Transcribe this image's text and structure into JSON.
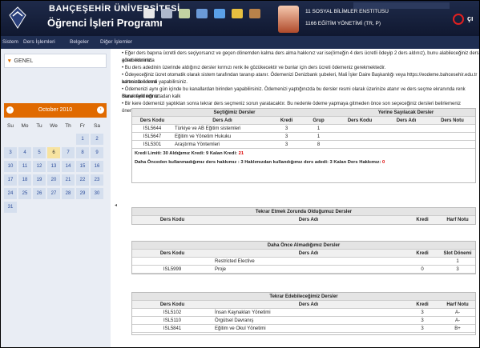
{
  "header": {
    "university": "BAHÇEŞEHİR ÜNİVERSİTESİ",
    "system": "Öğrenci İşleri Programı",
    "institute": "11 SOSYAL BİLİMLER ENSTİTÜSÜ",
    "program": "1166 EĞİTİM YÖNETİMİ (TR, P)",
    "exit": "çı"
  },
  "menu": [
    "Sistem",
    "Ders İşlemleri",
    "Belgeler",
    "Diğer İşlemler"
  ],
  "sidebar": {
    "genel": "GENEL"
  },
  "calendar": {
    "month": "October 2010",
    "dows": [
      "Su",
      "Mo",
      "Tu",
      "We",
      "Th",
      "Fr",
      "Sa"
    ],
    "weeks": [
      [
        "",
        "",
        "",
        "",
        "",
        "1",
        "2"
      ],
      [
        "3",
        "4",
        "5",
        "6",
        "7",
        "8",
        "9"
      ],
      [
        "10",
        "11",
        "12",
        "13",
        "14",
        "15",
        "16"
      ],
      [
        "17",
        "18",
        "19",
        "20",
        "21",
        "22",
        "23"
      ],
      [
        "24",
        "25",
        "26",
        "27",
        "28",
        "29",
        "30"
      ],
      [
        "31",
        "",
        "",
        "",
        "",
        "",
        ""
      ]
    ],
    "today": "6"
  },
  "bullets": [
    "Eğer ders bapına ücretli ders seçiyorsanız ve geçen dönemden kalma ders alma hakkınız var ise(örneğin 4 ders ücretli ödeyip 2 ders aldınız), bunu alabileceğiniz ders adedi kısmında",
    "görecekksiniz.",
    "Bu ders adedinin üzerinde aldığınız dersler kırmızı renk ile gözükecektir ve bunlar için ders ücreti ödemeniz gerekmektedir.",
    "Ödeyeceğiniz ücret otomatik olarak sistem tarafından taranıp atanır. Ödemenizi Denizbank şubeleri, Mali İşler Daire Başkanlığı veya https://eodeme.bahcesehir.edu.tr adresinden kredi",
    "kartınızla ödeme yapabilirsiniz.",
    "Ödemenizi aynı gün içinde bu kanallardan birinden yapabilirsiniz. Ödemenizi yaptığınızda bu dersler resmi olarak üzerinize atanır ve ders seçme ekranında renk olarak farklılığı ortadan kalk",
    "Bunu teyid ediniz.",
    "Bir kere ödemenizi yaptıktan sonra tekrar ders seçmeniz sorun yaratacaktır. Bu nedenle ödeme yapmaya gitmeden önce son seçeceğiniz dersleri belirlemeniz önemlidir."
  ],
  "selected": {
    "title": "Seçtiğimiz Dersler",
    "alt_title": "Yerine Sayılacak Dersler",
    "cols": [
      "Ders Kodu",
      "Ders Adı",
      "Kredi",
      "Grup"
    ],
    "alt_cols": [
      "Ders Kodu",
      "Ders Adı",
      "Ders Notu"
    ],
    "rows": [
      [
        "ISL5644",
        "Türkiye ve AB Eğitim sistemleri",
        "3",
        "1"
      ],
      [
        "ISL5647",
        "Eğitim ve Yönetim Hukuku",
        "3",
        "1"
      ],
      [
        "ISL5301",
        "Araştırma Yöntemleri",
        "3",
        "8"
      ]
    ],
    "limit_text": "Kredi Limiti: 30  Aldığımız Kredi: 9  Kalan Kredi: ",
    "kalan": "21",
    "hak_text": "Daha Önceden kullanmadığımız ders hakkımız : 3  Haklımızdan kullandığımız ders adedi: 3  Kalan Ders Hakkımız: ",
    "hak_kalan": "0"
  },
  "repeat": {
    "title": "Tekrar Etmek Zorunda Olduğumuz Dersler",
    "cols": [
      "Ders Kodu",
      "Ders Adı",
      "Kredi",
      "Harf Notu"
    ]
  },
  "notTaken": {
    "title": "Daha Önce Almadığımız Dersler",
    "cols": [
      "Ders Kodu",
      "Ders Adı",
      "Kredi",
      "Slot Dönemi"
    ],
    "rows": [
      [
        "",
        "Restricted Elective",
        "",
        "1"
      ],
      [
        "ISL5999",
        "Proje",
        "0",
        "3"
      ]
    ]
  },
  "repeatable": {
    "title": "Tekrar Edebileceğimiz Dersler",
    "cols": [
      "Ders Kodu",
      "Ders Adı",
      "Kredi",
      "Harf Notu"
    ],
    "rows": [
      [
        "ISL5102",
        "İnsan Kaynakları Yönetimi",
        "3",
        "A-"
      ],
      [
        "ISL5110",
        "Örgütsel Davranış",
        "3",
        "A-"
      ],
      [
        "ISL5841",
        "Eğitim ve Okul Yönetimi",
        "3",
        "B+"
      ]
    ]
  },
  "colors": {
    "header": "#1e2a4a",
    "calendar": "#e06a00",
    "red": "#d00000"
  }
}
